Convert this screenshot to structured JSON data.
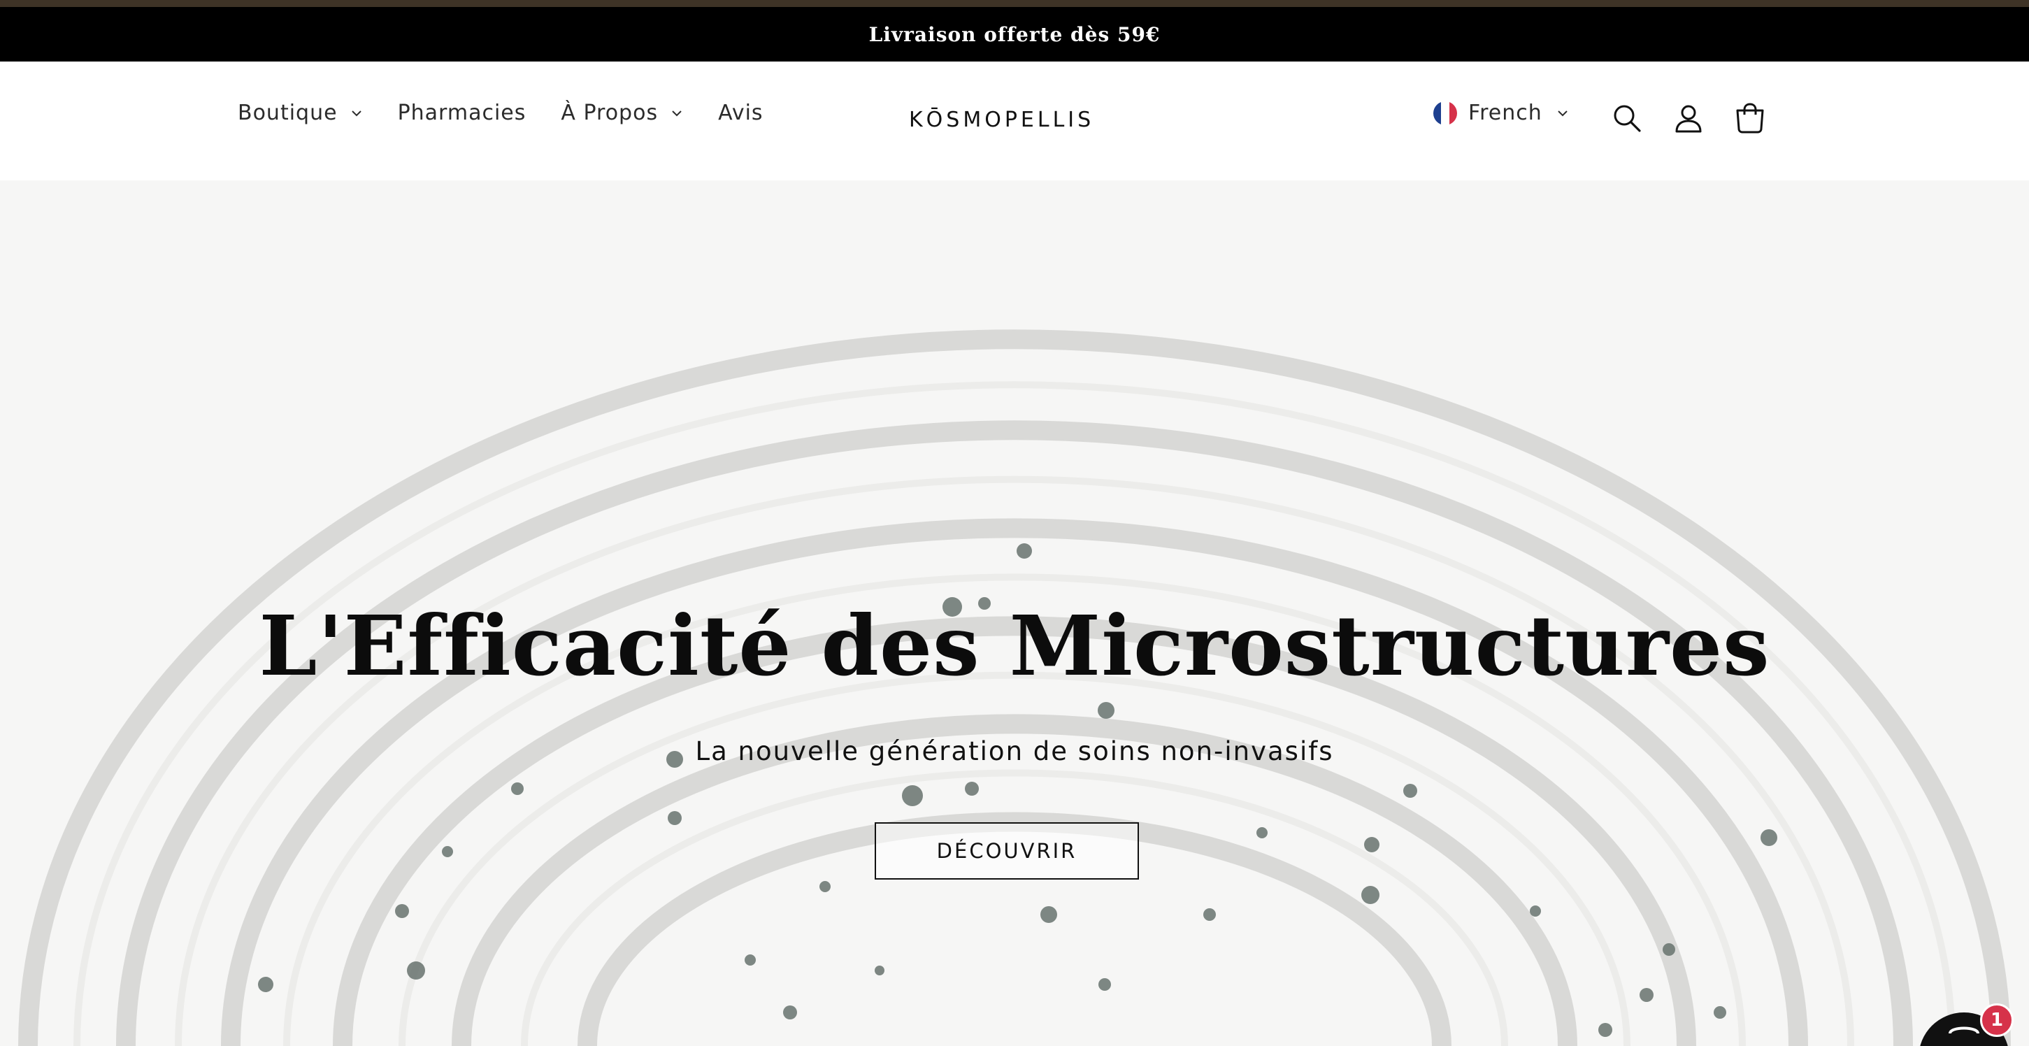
{
  "announcement": {
    "text": "Livraison offerte dès 59€"
  },
  "header": {
    "nav": [
      {
        "label": "Boutique",
        "has_dropdown": true
      },
      {
        "label": "Pharmacies",
        "has_dropdown": false
      },
      {
        "label": "À Propos",
        "has_dropdown": true
      },
      {
        "label": "Avis",
        "has_dropdown": false
      }
    ],
    "logo": "KŌSMOPELLIS",
    "language": {
      "label": "French",
      "flag_icon": "france-flag-icon"
    },
    "icons": [
      "search-icon",
      "account-icon",
      "cart-icon"
    ]
  },
  "hero": {
    "title": "L'Efficacité des Microstructures",
    "subtitle": "La nouvelle génération de soins non-invasifs",
    "cta_label": "DÉCOUVRIR"
  },
  "chat_widget": {
    "icon": "chat-icon",
    "badge_count": "1",
    "badge_color": "#d6324a"
  },
  "colors": {
    "announcement_bg": "#000000",
    "top_strip": "#3e3326",
    "text": "#111111"
  }
}
